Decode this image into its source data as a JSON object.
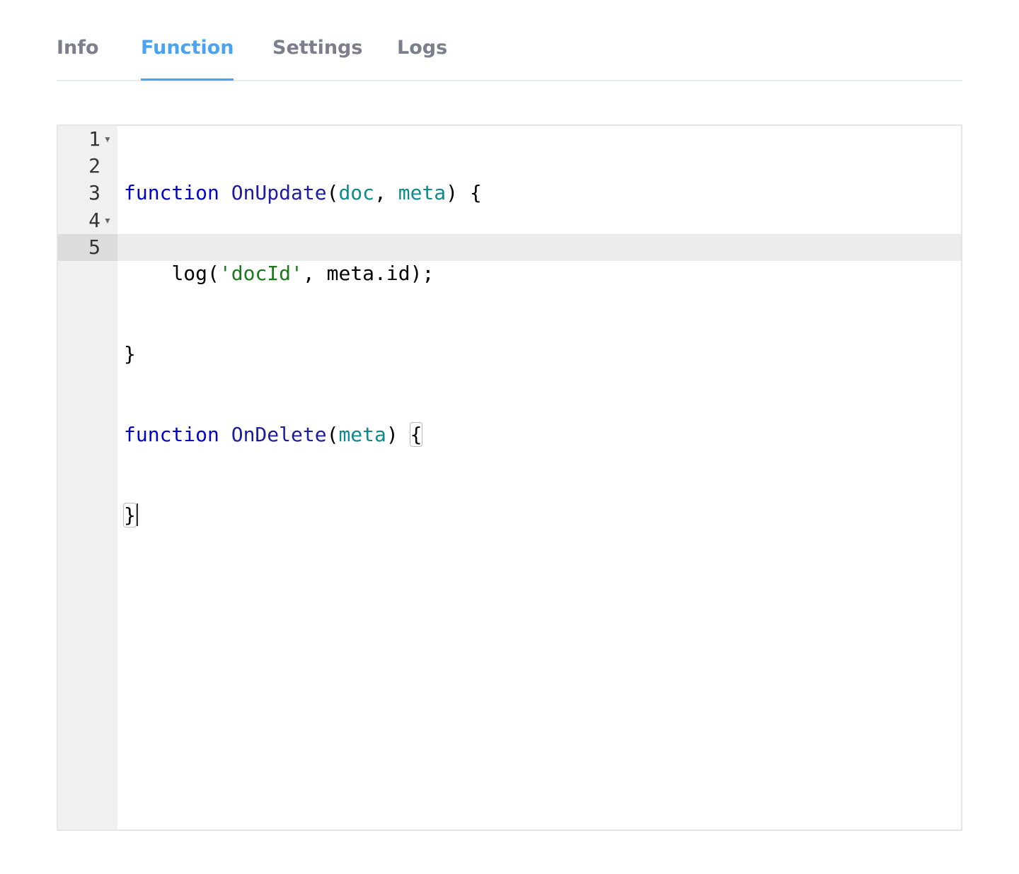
{
  "tabs": [
    {
      "label": "Info",
      "active": false
    },
    {
      "label": "Function",
      "active": true
    },
    {
      "label": "Settings",
      "active": false
    },
    {
      "label": "Logs",
      "active": false
    }
  ],
  "editor": {
    "line_numbers": [
      "1",
      "2",
      "3",
      "4",
      "5"
    ],
    "fold_icon": "fold-arrow-icon",
    "active_line": 5,
    "lines": [
      {
        "kw": "function",
        "fn": "OnUpdate",
        "open": "(",
        "p1": "doc",
        "sep": ", ",
        "p2": "meta",
        "close": ") {"
      },
      {
        "indent": "    ",
        "call": "log(",
        "str": "'docId'",
        "rest": ", meta.id);"
      },
      {
        "text": "}"
      },
      {
        "kw": "function",
        "fn": "OnDelete",
        "open": "(",
        "p1": "meta",
        "close": ") ",
        "brace": "{"
      },
      {
        "text": "}"
      }
    ]
  },
  "colors": {
    "active_tab": "#4aa3f0",
    "inactive_tab": "#7b7f8c",
    "keyword": "#0000cd",
    "parameter": "#0e8a8a",
    "string": "#1a7a1a"
  }
}
